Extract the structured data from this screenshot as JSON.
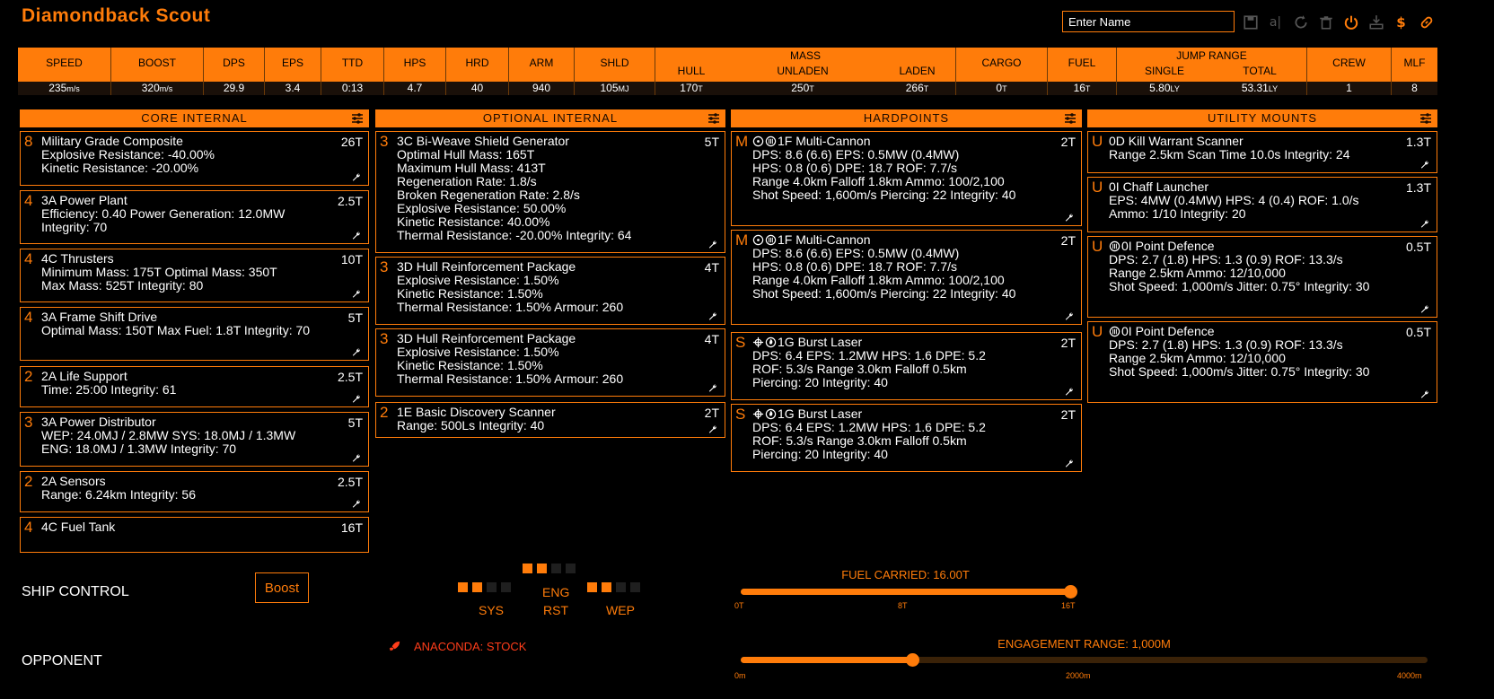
{
  "app_title": "Diamondback Scout",
  "name_input": {
    "placeholder": "Enter Name",
    "value": ""
  },
  "toolbar": {
    "icons": [
      "save-icon",
      "rename-icon",
      "reload-icon",
      "delete-icon",
      "power-icon",
      "export-icon",
      "cost-icon",
      "share-icon"
    ],
    "rename_glyph": "a|",
    "cost_glyph": "$"
  },
  "stats": {
    "speed": {
      "label": "SPEED",
      "value": "235",
      "unit": "m/s"
    },
    "boost": {
      "label": "BOOST",
      "value": "320",
      "unit": "m/s"
    },
    "dps": {
      "label": "DPS",
      "value": "29.9"
    },
    "eps": {
      "label": "EPS",
      "value": "3.4"
    },
    "ttd": {
      "label": "TTD",
      "value": "0:13"
    },
    "hps": {
      "label": "HPS",
      "value": "4.7"
    },
    "hrd": {
      "label": "HRD",
      "value": "40"
    },
    "arm": {
      "label": "ARM",
      "value": "940"
    },
    "shld": {
      "label": "SHLD",
      "value": "105",
      "unit": "MJ"
    },
    "mass": {
      "label": "MASS",
      "hull_label": "HULL",
      "hull": "170",
      "unladen_label": "UNLADEN",
      "unladen": "250",
      "laden_label": "LADEN",
      "laden": "266",
      "unit": "T"
    },
    "cargo": {
      "label": "CARGO",
      "value": "0",
      "unit": "T"
    },
    "fuel": {
      "label": "FUEL",
      "value": "16",
      "unit": "T"
    },
    "jump": {
      "label": "JUMP RANGE",
      "single_label": "SINGLE",
      "single": "5.80",
      "total_label": "TOTAL",
      "total": "53.31",
      "unit": "LY"
    },
    "crew": {
      "label": "CREW",
      "value": "1"
    },
    "mlf": {
      "label": "MLF",
      "value": "8"
    }
  },
  "sections": {
    "core": "CORE INTERNAL",
    "optional": "OPTIONAL INTERNAL",
    "hardpoints": "HARDPOINTS",
    "utility": "UTILITY MOUNTS"
  },
  "core": [
    {
      "cls": "8",
      "mass": "26T",
      "lines": [
        "Military Grade Composite",
        "Explosive Resistance: -40.00%",
        "Kinetic Resistance: -20.00%"
      ]
    },
    {
      "cls": "4",
      "mass": "2.5T",
      "lines": [
        "3A Power Plant",
        "Efficiency: 0.40   Power Generation: 12.0MW",
        "Integrity: 70"
      ]
    },
    {
      "cls": "4",
      "mass": "10T",
      "lines": [
        "4C Thrusters",
        "Minimum Mass: 175T   Optimal Mass: 350T",
        "Max Mass: 525T   Integrity: 80"
      ]
    },
    {
      "cls": "4",
      "mass": "5T",
      "lines": [
        "3A Frame Shift Drive",
        "Optimal Mass: 150T   Max Fuel: 1.8T   Integrity: 70"
      ]
    },
    {
      "cls": "2",
      "mass": "2.5T",
      "lines": [
        "2A Life Support",
        "Time: 25:00   Integrity: 61"
      ]
    },
    {
      "cls": "3",
      "mass": "5T",
      "lines": [
        "3A Power Distributor",
        "WEP: 24.0MJ / 2.8MW   SYS: 18.0MJ / 1.3MW",
        "ENG: 18.0MJ / 1.3MW   Integrity: 70"
      ]
    },
    {
      "cls": "2",
      "mass": "2.5T",
      "lines": [
        "2A Sensors",
        "Range: 6.24km   Integrity: 56"
      ]
    },
    {
      "cls": "4",
      "mass": "16T",
      "lines": [
        "4C Fuel Tank"
      ]
    }
  ],
  "optional": [
    {
      "cls": "3",
      "mass": "5T",
      "lines": [
        "3C Bi-Weave Shield Generator",
        "Optimal Hull Mass: 165T",
        "Maximum Hull Mass: 413T",
        "Regeneration Rate: 1.8/s",
        "Broken Regeneration Rate: 2.8/s",
        "Explosive Resistance: 50.00%",
        "Kinetic Resistance: 40.00%",
        "Thermal Resistance: -20.00%   Integrity: 64"
      ]
    },
    {
      "cls": "3",
      "mass": "4T",
      "lines": [
        "3D Hull Reinforcement Package",
        "Explosive Resistance: 1.50%",
        "Kinetic Resistance: 1.50%",
        "Thermal Resistance: 1.50%   Armour: 260"
      ]
    },
    {
      "cls": "3",
      "mass": "4T",
      "lines": [
        "3D Hull Reinforcement Package",
        "Explosive Resistance: 1.50%",
        "Kinetic Resistance: 1.50%",
        "Thermal Resistance: 1.50%   Armour: 260"
      ]
    },
    {
      "cls": "2",
      "mass": "2T",
      "lines": [
        "1E Basic Discovery Scanner",
        "Range: 500Ls   Integrity: 40"
      ]
    }
  ],
  "hardpoints": [
    {
      "cls": "M",
      "mass": "2T",
      "lines": [
        "1F Multi-Cannon",
        "DPS: 8.6 (6.6)   EPS: 0.5MW (0.4MW)",
        "HPS: 0.8 (0.6)   DPE: 18.7   ROF: 7.7/s",
        "Range 4.0km   Falloff 1.8km   Ammo: 100/2,100",
        "Shot Speed: 1,600m/s   Piercing: 22   Integrity: 40"
      ]
    },
    {
      "cls": "M",
      "mass": "2T",
      "lines": [
        "1F Multi-Cannon",
        "DPS: 8.6 (6.6)   EPS: 0.5MW (0.4MW)",
        "HPS: 0.8 (0.6)   DPE: 18.7   ROF: 7.7/s",
        "Range 4.0km   Falloff 1.8km   Ammo: 100/2,100",
        "Shot Speed: 1,600m/s   Piercing: 22   Integrity: 40"
      ]
    },
    {
      "cls": "S",
      "mass": "2T",
      "lines": [
        "1G Burst Laser",
        "DPS: 6.4   EPS: 1.2MW   HPS: 1.6   DPE: 5.2",
        "ROF: 5.3/s   Range 3.0km   Falloff 0.5km",
        "Piercing: 20   Integrity: 40"
      ]
    },
    {
      "cls": "S",
      "mass": "2T",
      "lines": [
        "1G Burst Laser",
        "DPS: 6.4   EPS: 1.2MW   HPS: 1.6   DPE: 5.2",
        "ROF: 5.3/s   Range 3.0km   Falloff 0.5km",
        "Piercing: 20   Integrity: 40"
      ]
    }
  ],
  "utility": [
    {
      "cls": "U",
      "mass": "1.3T",
      "lines": [
        "0D Kill Warrant Scanner",
        "Range 2.5km   Scan Time 10.0s   Integrity: 24"
      ]
    },
    {
      "cls": "U",
      "mass": "1.3T",
      "lines": [
        "0I Chaff Launcher",
        "EPS: 4MW (0.4MW)   HPS: 4 (0.4)   ROF: 1.0/s",
        "Ammo: 1/10   Integrity: 20"
      ]
    },
    {
      "cls": "U",
      "mass": "0.5T",
      "lines": [
        "0I Point Defence",
        "DPS: 2.7 (1.8)   HPS: 1.3 (0.9)   ROF: 13.3/s",
        "Range 2.5km   Ammo: 12/10,000",
        "Shot Speed: 1,000m/s   Jitter: 0.75°   Integrity: 30"
      ]
    },
    {
      "cls": "U",
      "mass": "0.5T",
      "lines": [
        "0I Point Defence",
        "DPS: 2.7 (1.8)   HPS: 1.3 (0.9)   ROF: 13.3/s",
        "Range 2.5km   Ammo: 12/10,000",
        "Shot Speed: 1,000m/s   Jitter: 0.75°   Integrity: 30"
      ]
    }
  ],
  "ship_control": {
    "label": "SHIP CONTROL",
    "boost_label": "Boost",
    "pips": {
      "sys_label": "SYS",
      "eng_label": "ENG",
      "wep_label": "WEP",
      "rst_label": "RST",
      "sys": 2,
      "eng": 2,
      "wep": 2
    },
    "fuel": {
      "title": "FUEL CARRIED: 16.00T",
      "min": "0T",
      "mid": "8T",
      "max": "16T",
      "fraction": 1.0
    }
  },
  "opponent": {
    "label": "OPPONENT",
    "name": "ANACONDA: STOCK",
    "engagement": {
      "title": "ENGAGEMENT RANGE: 1,000M",
      "min": "0m",
      "mid": "2000m",
      "max": "4000m",
      "fraction": 0.25
    }
  },
  "colors": {
    "accent": "#ff7c0a",
    "opponent": "#ff3d1a",
    "bg": "#000000"
  }
}
